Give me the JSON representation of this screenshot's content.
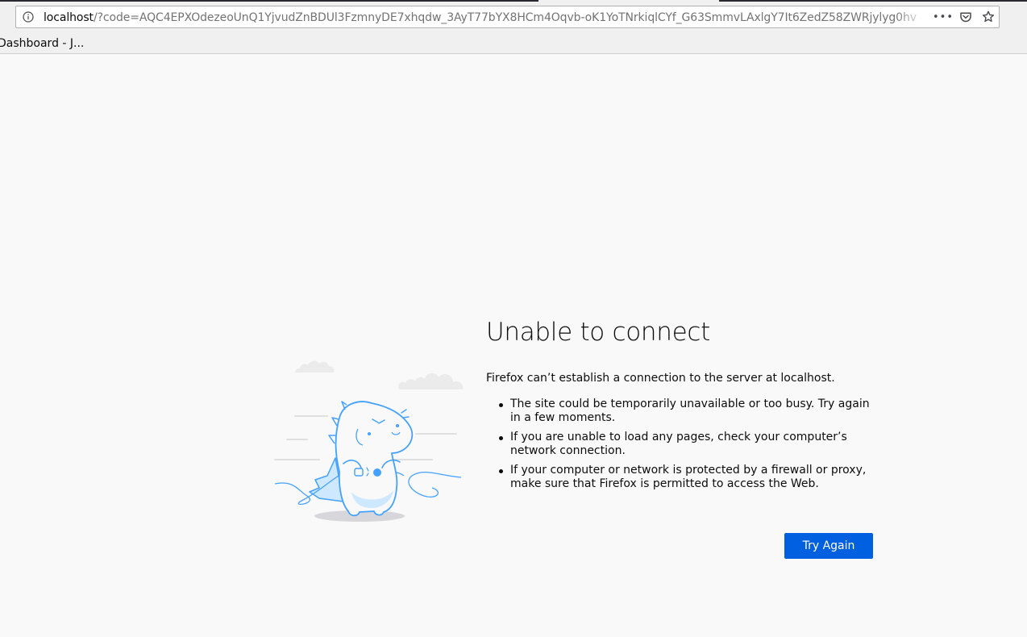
{
  "browser": {
    "url_host": "localhost",
    "url_rest": "/?code=AQC4EPXOdezeoUnQ1YjvudZnBDUl3FzmnyDE7xhqdw_3AyT77bYX8HCm4Oqvb-oK1YoTNrkiqlCYf_G63SmmvLAxlgY7It6ZedZ58ZWRjylyg0hv",
    "page_actions_label": "•••",
    "icons": [
      "info-icon",
      "page-actions-icon",
      "pocket-icon",
      "bookmark-star-icon"
    ]
  },
  "bookmarks": {
    "items": [
      {
        "label": "Dashboard - J..."
      }
    ]
  },
  "error": {
    "title": "Unable to connect",
    "intro": "Firefox can’t establish a connection to the server at localhost.",
    "bullets": [
      "The site could be temporarily unavailable or too busy. Try again in a few moments.",
      "If you are unable to load any pages, check your computer’s network connection.",
      "If your computer or network is protected by a firewall or proxy, make sure that Firefox is permitted to access the Web."
    ],
    "button_label": "Try Again"
  },
  "colors": {
    "accent": "#0060df",
    "page_bg": "#f9f9fa",
    "illustration": "#45a1ff"
  }
}
